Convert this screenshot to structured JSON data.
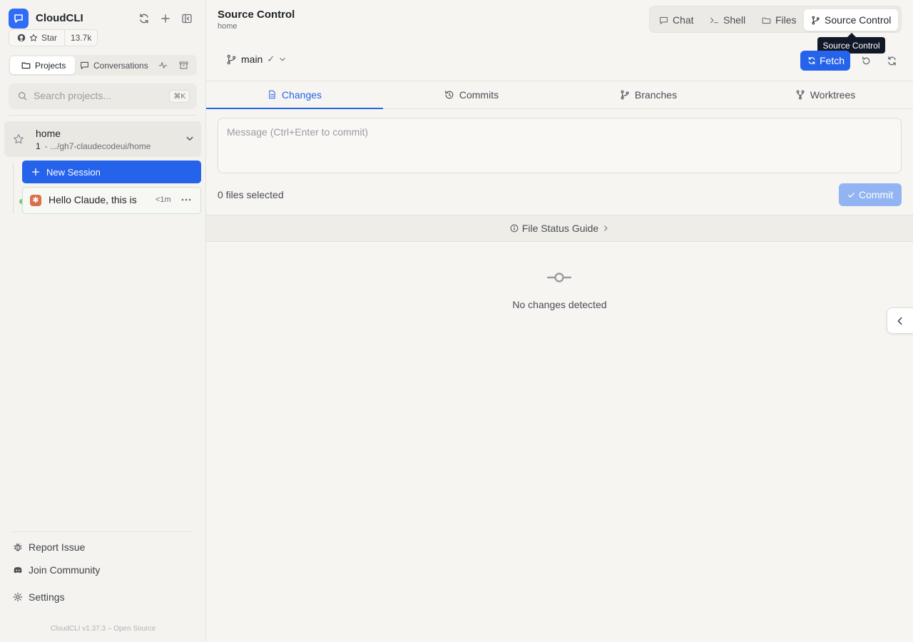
{
  "app": {
    "name": "CloudCLI",
    "accent": "#2563eb"
  },
  "github": {
    "star_label": "Star",
    "star_count": "13.7k"
  },
  "sidebar": {
    "tabs": [
      {
        "label": "Projects"
      },
      {
        "label": "Conversations"
      }
    ],
    "search": {
      "placeholder": "Search projects...",
      "shortcut": "⌘K"
    },
    "project": {
      "name": "home",
      "session_count": "1",
      "path": "- .../gh7-claudecodeui/home"
    },
    "new_session_label": "New Session",
    "session": {
      "title": "Hello Claude, this is",
      "time": "<1m"
    },
    "footer": [
      {
        "label": "Report Issue"
      },
      {
        "label": "Join Community"
      },
      {
        "label": "Settings"
      }
    ],
    "version": "CloudCLI v1.37.3 – Open Source"
  },
  "header": {
    "title": "Source Control",
    "subtitle": "home",
    "tabs": [
      {
        "label": "Chat"
      },
      {
        "label": "Shell"
      },
      {
        "label": "Files"
      },
      {
        "label": "Source Control"
      }
    ],
    "tooltip": "Source Control"
  },
  "source_control": {
    "branch": "main",
    "branch_status": "✓",
    "fetch_label": "Fetch",
    "tabs": [
      {
        "label": "Changes"
      },
      {
        "label": "Commits"
      },
      {
        "label": "Branches"
      },
      {
        "label": "Worktrees"
      }
    ],
    "message_placeholder": "Message (Ctrl+Enter to commit)",
    "files_selected": "0 files selected",
    "commit_label": "Commit",
    "guide_label": "File Status Guide",
    "empty_text": "No changes detected"
  }
}
